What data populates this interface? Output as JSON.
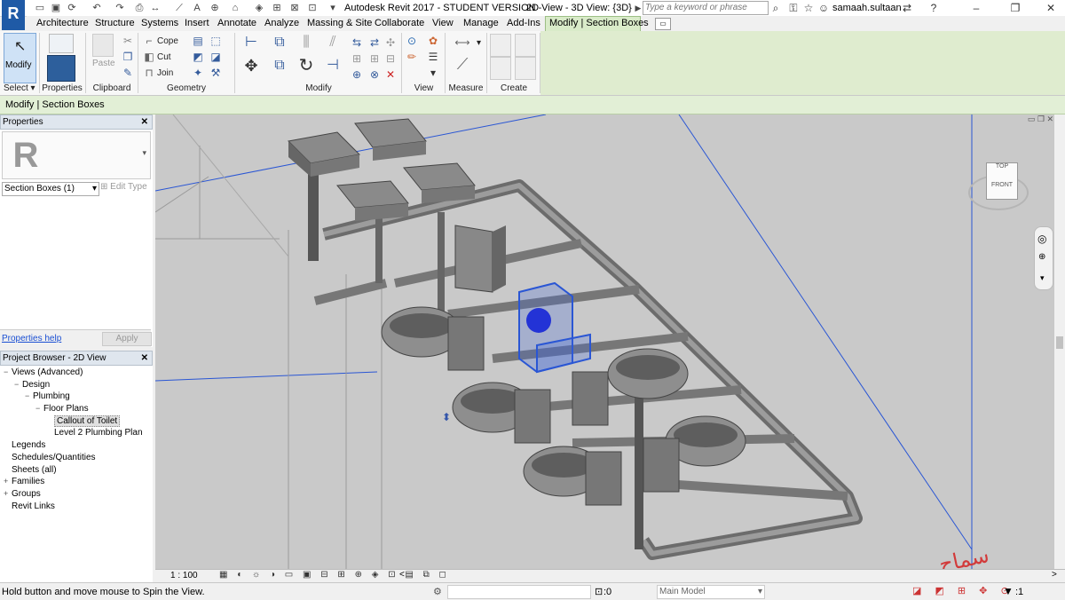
{
  "titlebar": {
    "app_title": "Autodesk Revit 2017 - STUDENT VERSION -",
    "view_title": "2D View - 3D View: {3D}",
    "search_placeholder": "Type a keyword or phrase",
    "username": "samaah.sultaan"
  },
  "tabs": [
    "Architecture",
    "Structure",
    "Systems",
    "Insert",
    "Annotate",
    "Analyze",
    "Massing & Site",
    "Collaborate",
    "View",
    "Manage",
    "Add-Ins",
    "Modify | Section Boxes"
  ],
  "ribbon": {
    "modify_label": "Modify",
    "paste_label": "Paste",
    "cope_label": "Cope",
    "cut_label": "Cut",
    "join_label": "Join",
    "panels": {
      "select": "Select",
      "properties": "Properties",
      "clipboard": "Clipboard",
      "geometry": "Geometry",
      "modify": "Modify",
      "view": "View",
      "measure": "Measure",
      "create": "Create"
    }
  },
  "context_bar": "Modify | Section Boxes",
  "properties": {
    "header": "Properties",
    "type_selector": "Section Boxes (1)",
    "edit_type": "Edit Type",
    "help_link": "Properties help",
    "apply_button": "Apply"
  },
  "project_browser": {
    "header": "Project Browser - 2D View",
    "items": [
      {
        "label": "Views (Advanced)",
        "level": 0,
        "toggle": "−"
      },
      {
        "label": "Design",
        "level": 1,
        "toggle": "−"
      },
      {
        "label": "Plumbing",
        "level": 2,
        "toggle": "−"
      },
      {
        "label": "Floor Plans",
        "level": 3,
        "toggle": "−"
      },
      {
        "label": "Callout of Toilet",
        "level": 4,
        "toggle": "",
        "selected": true
      },
      {
        "label": "Level 2 Plumbing Plan",
        "level": 4,
        "toggle": ""
      },
      {
        "label": "Legends",
        "level": 0,
        "toggle": ""
      },
      {
        "label": "Schedules/Quantities",
        "level": 0,
        "toggle": ""
      },
      {
        "label": "Sheets (all)",
        "level": 0,
        "toggle": ""
      },
      {
        "label": "Families",
        "level": 0,
        "toggle": "+"
      },
      {
        "label": "Groups",
        "level": 0,
        "toggle": "+"
      },
      {
        "label": "Revit Links",
        "level": 0,
        "toggle": ""
      }
    ]
  },
  "viewcube": {
    "label": "FRONT",
    "top_label": "TOP"
  },
  "view_control_bar": {
    "scale": "1 : 100"
  },
  "status": {
    "message": "Hold button and move mouse to Spin the View.",
    "selection_count": ":0",
    "workset": "Main Model",
    "filter_count": ":1"
  },
  "watermark_text": "سماح سلطان",
  "colors": {
    "ribbon_context_green": "#e2efd6",
    "selection_blue": "#2a56d4",
    "viewport_bg": "#c9c9c9",
    "logo_blue": "#1f5aa6",
    "watermark_red": "#d23a3a"
  }
}
